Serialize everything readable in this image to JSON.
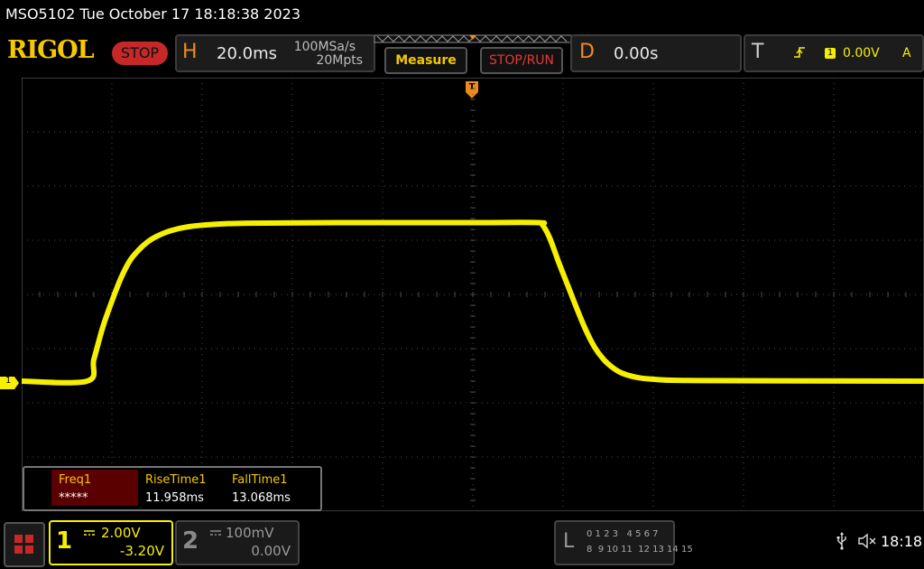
{
  "header": {
    "device_title": "MSO5102  Tue October 17 18:18:38 2023",
    "logo": "RIGOL",
    "run_status": "STOP",
    "horizontal": {
      "letter": "H",
      "timebase": "20.0ms",
      "sample_rate": "100MSa/s",
      "memory_depth": "20Mpts"
    },
    "measure_label": "Measure",
    "stop_run_label": "STOP/RUN",
    "delay": {
      "letter": "D",
      "value": "0.00s"
    },
    "trigger": {
      "letter": "T",
      "channel": "1",
      "level": "0.00V",
      "mode": "A"
    }
  },
  "trigger_marker": "T",
  "channel_marker": "1",
  "measurements": {
    "columns": [
      {
        "name": "Freq1",
        "value": "*****"
      },
      {
        "name": "RiseTime1",
        "value": "11.958ms"
      },
      {
        "name": "FallTime1",
        "value": "13.068ms"
      }
    ]
  },
  "footer": {
    "ch1": {
      "number": "1",
      "scale": "2.00V",
      "offset": "-3.20V"
    },
    "ch2": {
      "number": "2",
      "scale": "100mV",
      "offset": "0.00V"
    },
    "logic": {
      "letter": "L",
      "row1": "0 1 2 3   4 5 6 7",
      "row2": "8  9 10 11  12 13 14 15"
    },
    "time": "18:18"
  },
  "colors": {
    "ch1": "#f6f000",
    "trigger": "#f08a1c",
    "stop": "#c62828",
    "grid": "#4a4a4a",
    "measure_text": "#f6c800"
  },
  "waveform": {
    "unit_x": "ms",
    "unit_y": "V",
    "points": [
      [
        -100,
        -3.2
      ],
      [
        -85.5,
        -3.2
      ],
      [
        -84,
        -2.4
      ],
      [
        -82,
        -1.2
      ],
      [
        -80,
        -0.25
      ],
      [
        -78,
        0.6
      ],
      [
        -76,
        1.25
      ],
      [
        -74,
        1.65
      ],
      [
        -72,
        1.95
      ],
      [
        -70,
        2.15
      ],
      [
        -67,
        2.35
      ],
      [
        -63,
        2.5
      ],
      [
        -58,
        2.58
      ],
      [
        -50,
        2.63
      ],
      [
        -30,
        2.65
      ],
      [
        0,
        2.65
      ],
      [
        14.5,
        2.65
      ],
      [
        15.5,
        2.55
      ],
      [
        17,
        2.1
      ],
      [
        19,
        1.2
      ],
      [
        21,
        0.35
      ],
      [
        23,
        -0.5
      ],
      [
        25,
        -1.3
      ],
      [
        27,
        -1.95
      ],
      [
        29,
        -2.4
      ],
      [
        31,
        -2.7
      ],
      [
        33,
        -2.9
      ],
      [
        36,
        -3.05
      ],
      [
        40,
        -3.13
      ],
      [
        50,
        -3.18
      ],
      [
        100,
        -3.2
      ]
    ],
    "time_per_div": 20,
    "volts_per_div": 2.0,
    "offset_v": -3.2,
    "h_divs": 10,
    "v_divs": 8
  }
}
